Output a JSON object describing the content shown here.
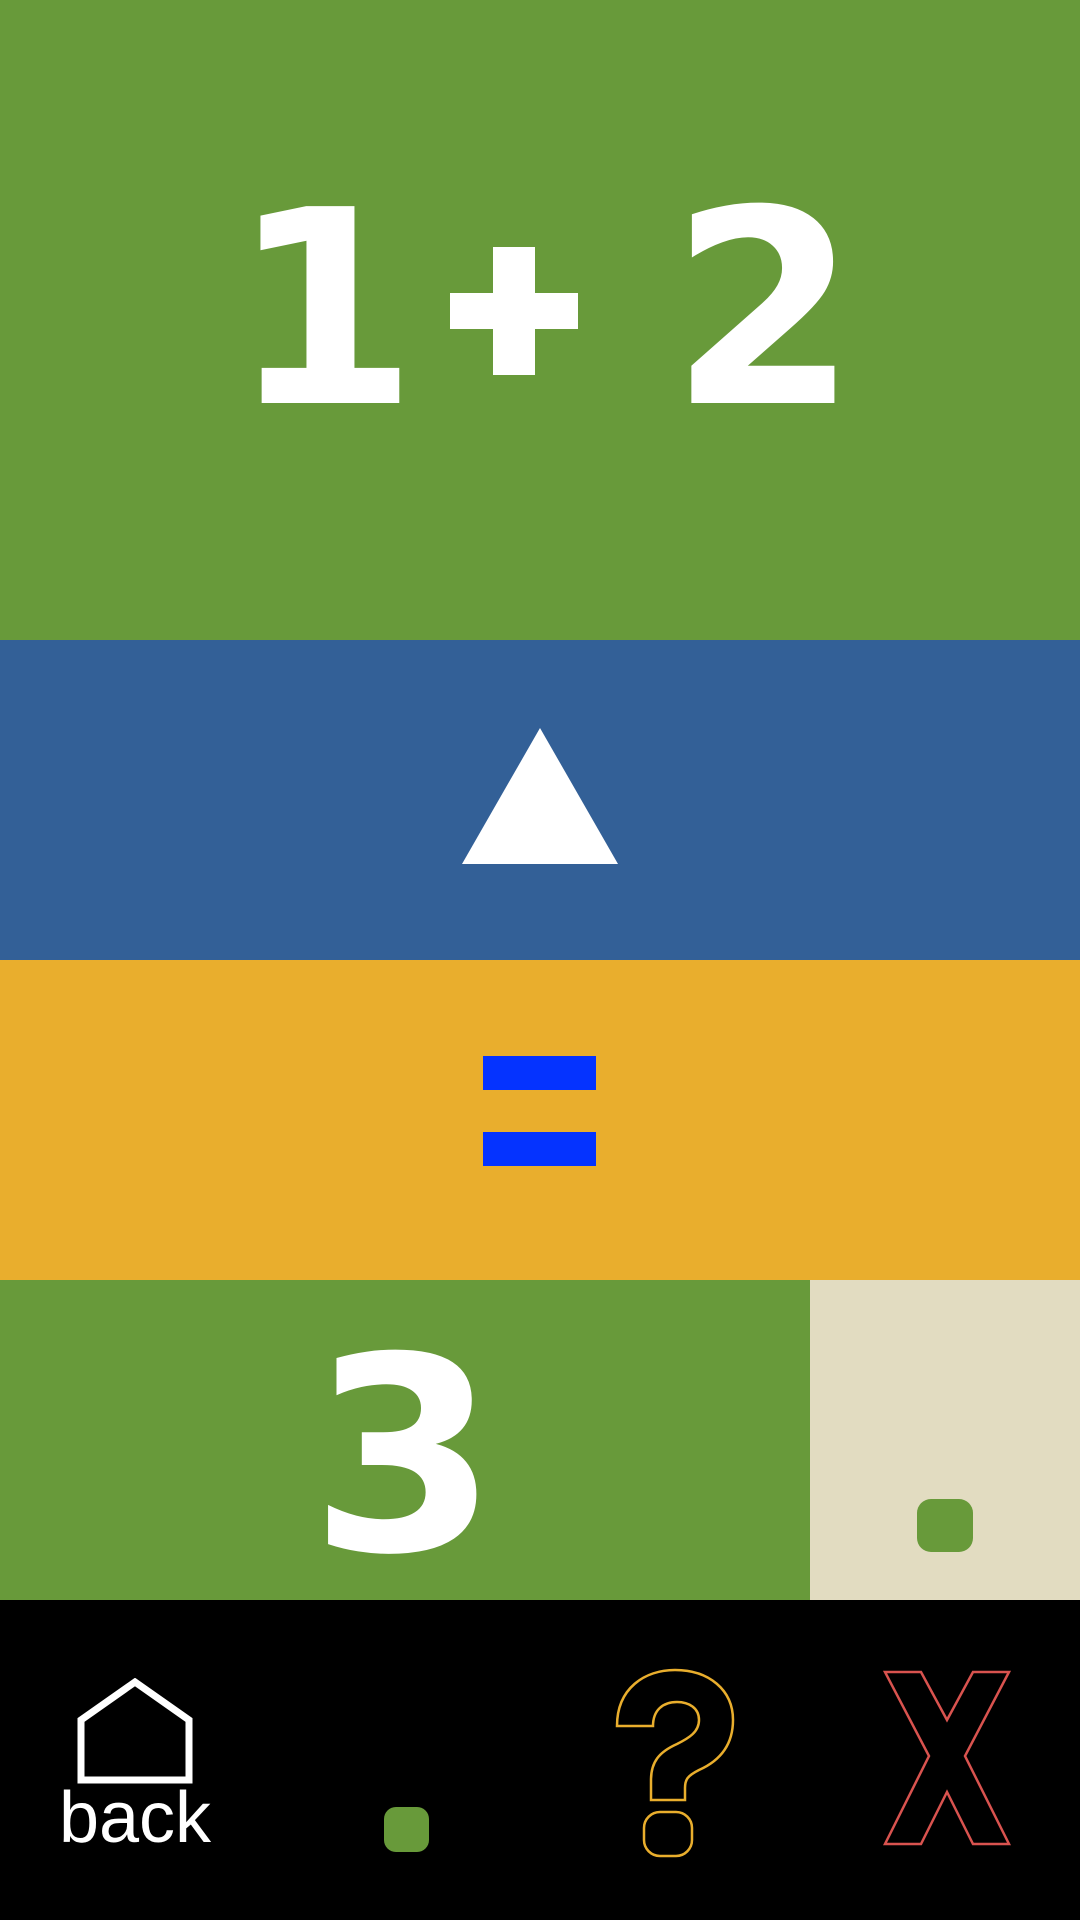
{
  "equation": {
    "operand_a": "1",
    "operator_icon": "plus-icon",
    "operand_b": "2"
  },
  "operator_selector": {
    "icon": "triangle-up-icon"
  },
  "equals": {
    "icon": "equals-icon"
  },
  "answer": {
    "value": "3",
    "slot_icon": "dot-icon"
  },
  "nav": {
    "back_label": "back",
    "home_icon": "home-icon",
    "dot_icon": "dot-icon",
    "help_icon": "question-mark-icon",
    "close_icon": "x-icon"
  },
  "colors": {
    "green": "#689a3a",
    "blue": "#336097",
    "yellow": "#e9ae2d",
    "cream": "#e2dcc1",
    "equals_blue": "#0533ff",
    "help_orange": "#e9ae2d",
    "close_red": "#d9534f"
  }
}
